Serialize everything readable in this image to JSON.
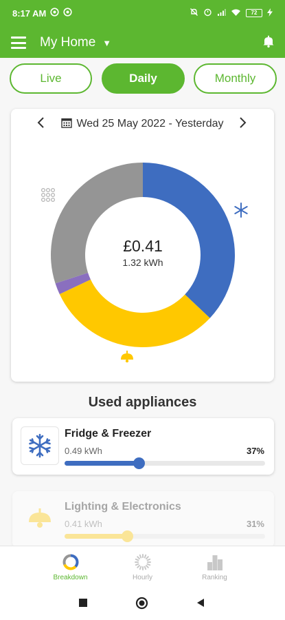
{
  "status_bar": {
    "time": "8:17 AM",
    "battery": "72"
  },
  "header": {
    "menu_icon": "hamburger-menu-icon",
    "home_label": "My Home",
    "dropdown_icon": "caret-down-icon",
    "notification_icon": "bell-icon"
  },
  "tabs": [
    {
      "label": "Live",
      "active": false
    },
    {
      "label": "Daily",
      "active": true
    },
    {
      "label": "Monthly",
      "active": false
    }
  ],
  "date_nav": {
    "label": "Wed 25 May 2022 - Yesterday",
    "prev_icon": "chevron-left-icon",
    "next_icon": "chevron-right-icon",
    "calendar_icon": "calendar-icon"
  },
  "summary": {
    "cost": "£0.41",
    "energy": "1.32 kWh"
  },
  "chart_data": {
    "type": "pie",
    "values_percent": [
      37,
      31,
      2,
      30
    ],
    "colors": [
      "#3e6dc0",
      "#ffc800",
      "#8a6fbf",
      "#959595"
    ],
    "icons": [
      "snowflake-icon",
      "lamp-icon",
      "",
      "grid-icon"
    ]
  },
  "section_title": "Used appliances",
  "appliances": [
    {
      "name": "Fridge & Freezer",
      "energy": "0.49 kWh",
      "percent_label": "37%",
      "percent": 37,
      "color": "#3e6dc0",
      "icon": "snowflake-icon"
    },
    {
      "name": "Lighting & Electronics",
      "energy": "0.41 kWh",
      "percent_label": "31%",
      "percent": 31,
      "color": "#ffc800",
      "icon": "lamp-icon"
    }
  ],
  "bottom_nav": [
    {
      "label": "Breakdown",
      "icon": "breakdown-ring-icon",
      "active": true
    },
    {
      "label": "Hourly",
      "icon": "hourly-clock-icon",
      "active": false
    },
    {
      "label": "Ranking",
      "icon": "ranking-bars-icon",
      "active": false
    }
  ],
  "accent": "#5cb730"
}
